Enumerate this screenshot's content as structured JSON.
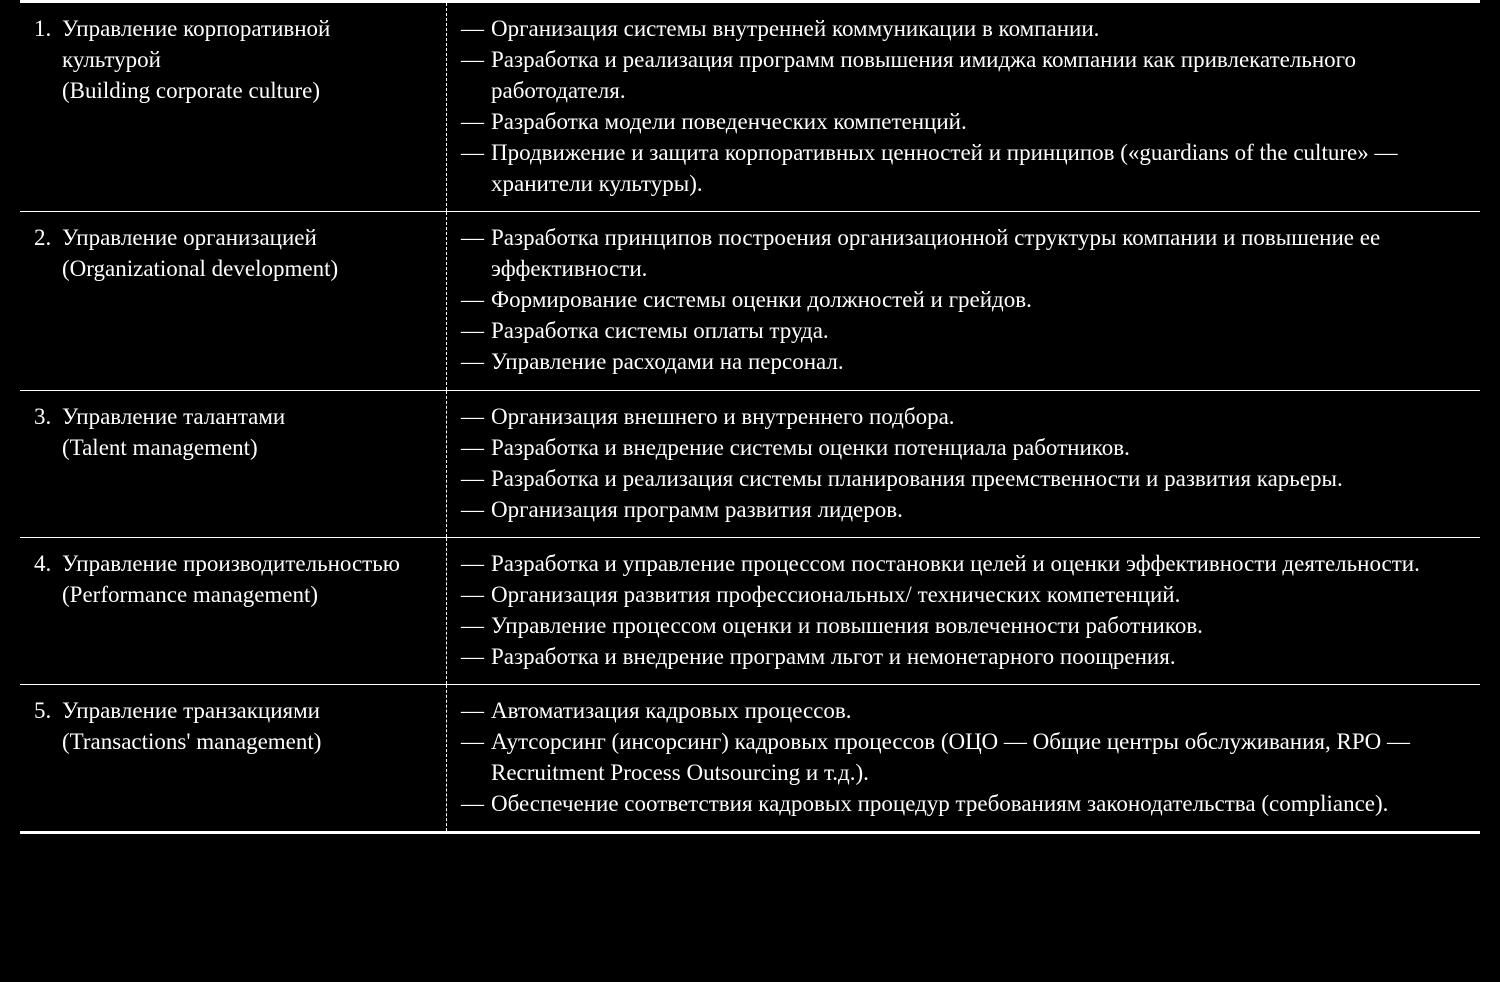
{
  "rows": [
    {
      "num": "1.",
      "title": "Управление корпоративной культурой",
      "subtitle": "(Building corporate culture)",
      "items": [
        "Организация системы внутренней коммуникации в компании.",
        "Разработка и реализация программ повышения имиджа компании как привлекательного работодателя.",
        "Разработка модели поведенческих компетенций.",
        "Продвижение и защита корпоративных ценностей и принципов («guardians of the culture» — хранители культуры)."
      ]
    },
    {
      "num": "2.",
      "title": "Управление организацией",
      "subtitle": "(Organizational development)",
      "items": [
        "Разработка принципов построения организационной структуры компании и повышение ее эффективности.",
        "Формирование системы оценки должностей и грейдов.",
        "Разработка системы оплаты труда.",
        "Управление расходами на персонал."
      ]
    },
    {
      "num": "3.",
      "title": "Управление талантами",
      "subtitle": "(Talent management)",
      "items": [
        "Организация внешнего и внутреннего подбора.",
        "Разработка и внедрение системы оценки потенциала работников.",
        "Разработка и реализация системы планирования преемственности и развития карьеры.",
        "Организация программ развития лидеров."
      ]
    },
    {
      "num": "4.",
      "title": "Управление производительностью",
      "subtitle": "(Performance management)",
      "items": [
        "Разработка и управление процессом постановки целей и оценки эффективности деятельности.",
        "Организация развития профессиональных/ технических компетенций.",
        "Управление процессом оценки и повышения вовлеченности работников.",
        "Разработка и внедрение программ льгот и немонетарного поощрения."
      ]
    },
    {
      "num": "5.",
      "title": "Управление транзакциями",
      "subtitle": "(Transactions' management)",
      "items": [
        "Автоматизация кадровых процессов.",
        "Аутсорсинг (инсорсинг) кадровых процессов (ОЦО — Общие центры обслуживания, RPO — Recruitment Process Outsourcing и т.д.).",
        "Обеспечение соответствия кадровых процедур требованиям законодательства (compliance)."
      ]
    }
  ]
}
